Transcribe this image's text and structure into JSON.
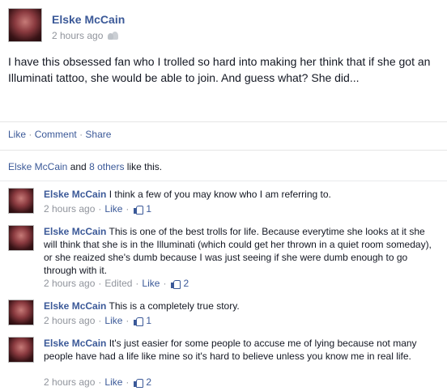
{
  "post": {
    "author": "Elske McCain",
    "timestamp": "2 hours ago",
    "privacy_icon": "friends-icon",
    "text": "I have this obsessed fan who I trolled so hard into making her think that if she got an Illuminati tattoo, she would be able to join. And guess what? She did..."
  },
  "actions": {
    "like": "Like",
    "comment": "Comment",
    "share": "Share",
    "separator": "·"
  },
  "likes": {
    "name": "Elske McCain",
    "and": "and",
    "others": "8 others",
    "suffix": "like this."
  },
  "comments": [
    {
      "author": "Elske McCain",
      "text": "I think a few of you may know who I am referring to.",
      "time": "2 hours ago",
      "edited": "",
      "like_label": "Like",
      "likes": "1"
    },
    {
      "author": "Elske McCain",
      "text": "This is one of the best trolls for life. Because everytime she looks at it she will think that she is in the Illuminati (which could get her thrown in a quiet room someday), or she reaized she's dumb because I was just seeing if she were dumb enough to go through with it.",
      "time": "2 hours ago",
      "edited": "Edited",
      "like_label": "Like",
      "likes": "2"
    },
    {
      "author": "Elske McCain",
      "text": "This is a completely true story.",
      "time": "2 hours ago",
      "edited": "",
      "like_label": "Like",
      "likes": "1"
    },
    {
      "author": "Elske McCain",
      "text": "It's just easier for some people to accuse me of lying because not many people have had a life like mine so it's hard to believe unless you know me in real life.",
      "time": "2 hours ago",
      "edited": "",
      "like_label": "Like",
      "likes": "2"
    }
  ]
}
